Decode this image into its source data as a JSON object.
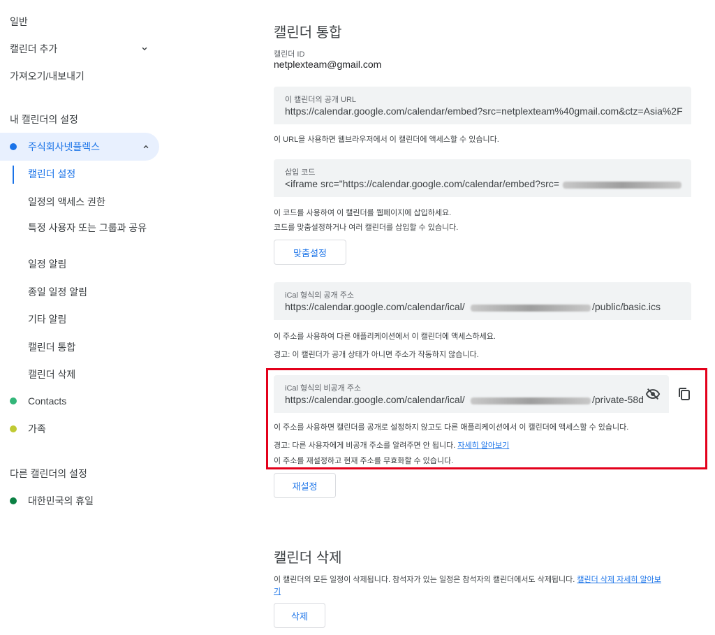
{
  "sidebar": {
    "general": "일반",
    "add_calendar": "캘린더 추가",
    "import_export": "가져오기/내보내기",
    "my_calendars_heading": "내 캘린더의 설정",
    "my_calendars": [
      {
        "label": "주식회사넷플렉스",
        "color": "#1a73e8"
      },
      {
        "label": "Contacts",
        "color": "#33b679"
      },
      {
        "label": "가족",
        "color": "#c0ca33"
      }
    ],
    "sub_items": [
      "캘린더 설정",
      "일정의 액세스 권한",
      "특정 사용자 또는 그룹과 공유",
      "일정 알림",
      "종일 일정 알림",
      "기타 알림",
      "캘린더 통합",
      "캘린더 삭제"
    ],
    "other_calendars_heading": "다른 캘린더의 설정",
    "other_calendars": [
      {
        "label": "대한민국의 휴일",
        "color": "#0b8043"
      }
    ]
  },
  "integration": {
    "title": "캘린더 통합",
    "calendar_id_label": "캘린더 ID",
    "calendar_id": "netplexteam@gmail.com",
    "public_url_label": "이 캘린더의 공개 URL",
    "public_url": "https://calendar.google.com/calendar/embed?src=netplexteam%40gmail.com&ctz=Asia%2F",
    "public_url_desc": "이 URL을 사용하면 웹브라우저에서 이 캘린더에 액세스할 수 있습니다.",
    "embed_label": "삽입 코드",
    "embed_code": "<iframe src=\"https://calendar.google.com/calendar/embed?src=",
    "embed_desc1": "이 코드를 사용하여 이 캘린더를 웹페이지에 삽입하세요.",
    "embed_desc2": "코드를 맞춤설정하거나 여러 캘린더를 삽입할 수 있습니다.",
    "customize_button": "맞춤설정",
    "ical_public_label": "iCal 형식의 공개 주소",
    "ical_public_prefix": "https://calendar.google.com/calendar/ical/",
    "ical_public_suffix": "/public/basic.ics",
    "ical_public_desc": "이 주소를 사용하여 다른 애플리케이션에서 이 캘린더에 액세스하세요.",
    "ical_public_warning": "경고: 이 캘린더가 공개 상태가 아니면 주소가 작동하지 않습니다.",
    "ical_private_label": "iCal 형식의 비공개 주소",
    "ical_private_prefix": "https://calendar.google.com/calendar/ical/",
    "ical_private_suffix": "/private-58d",
    "ical_private_desc": "이 주소를 사용하면 캘린더를 공개로 설정하지 않고도 다른 애플리케이션에서 이 캘린더에 액세스할 수 있습니다.",
    "ical_private_warning": "경고: 다른 사용자에게 비공개 주소를 알려주면 안 됩니다.",
    "learn_more": "자세히 알아보기",
    "reset_desc": "이 주소를 재설정하고 현재 주소를 무효화할 수 있습니다.",
    "reset_button": "재설정"
  },
  "delete_section": {
    "title": "캘린더 삭제",
    "desc": "이 캘린더의 모든 일정이 삭제됩니다. 참석자가 있는 일정은 참석자의 캘린더에서도 삭제됩니다.",
    "link_line1": "캘린더 삭제 자세히 알아보",
    "link_line2": "기",
    "delete_button": "삭제"
  },
  "icons": {
    "chevron_down": "chevron-down-icon",
    "chevron_up": "chevron-up-icon",
    "visibility_off": "visibility-off-icon",
    "copy": "copy-icon"
  }
}
